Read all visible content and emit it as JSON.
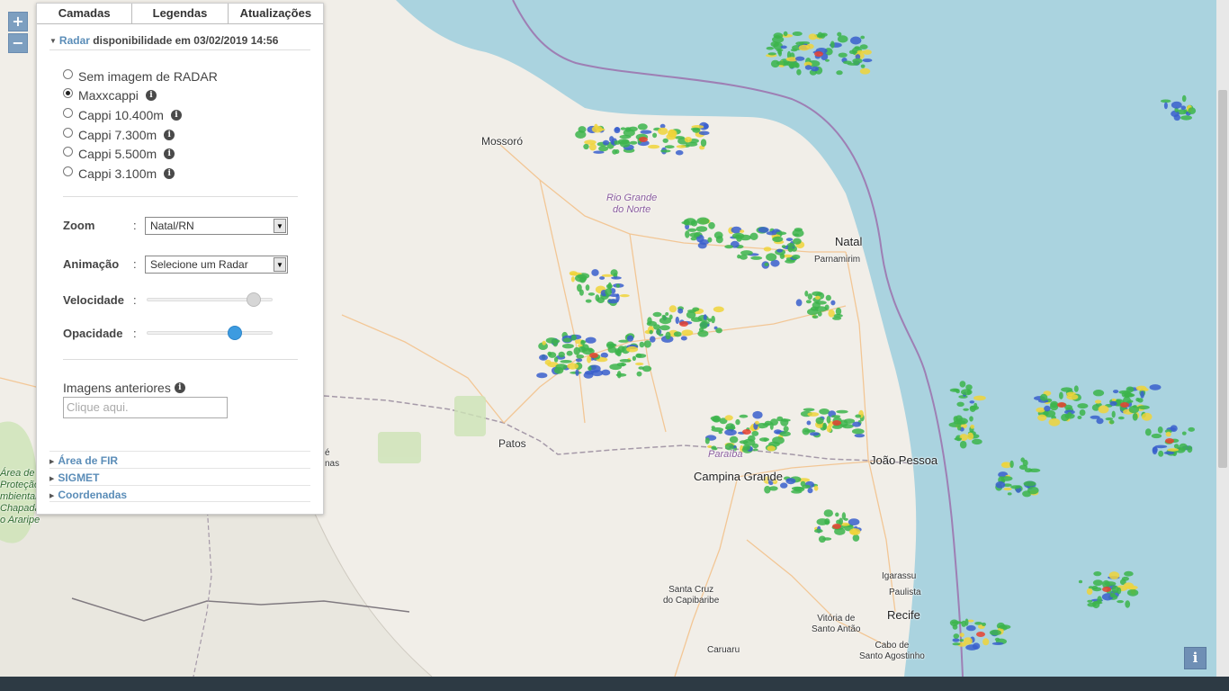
{
  "tabs": [
    "Camadas",
    "Legendas",
    "Atualizações"
  ],
  "radar": {
    "link_label": "Radar",
    "availability": "disponibilidade em 03/02/2019 14:56",
    "options": [
      {
        "label": "Sem imagem de RADAR",
        "selected": false,
        "info": false
      },
      {
        "label": "Maxxcappi",
        "selected": true,
        "info": true
      },
      {
        "label": "Cappi 10.400m",
        "selected": false,
        "info": true
      },
      {
        "label": "Cappi 7.300m",
        "selected": false,
        "info": true
      },
      {
        "label": "Cappi 5.500m",
        "selected": false,
        "info": true
      },
      {
        "label": "Cappi 3.100m",
        "selected": false,
        "info": true
      }
    ]
  },
  "controls": {
    "zoom_label": "Zoom",
    "zoom_value": "Natal/RN",
    "animation_label": "Animação",
    "animation_value": "Selecione um Radar",
    "speed_label": "Velocidade",
    "speed_level": 0.89,
    "opacity_label": "Opacidade",
    "opacity_level": 0.72,
    "colon": ":"
  },
  "previous": {
    "label": "Imagens anteriores",
    "placeholder": "Clique aqui."
  },
  "sections": [
    "Área de FIR",
    "SIGMET",
    "Coordenadas"
  ],
  "zoom_buttons": {
    "plus": "+",
    "minus": "−"
  },
  "info_button": "i",
  "map_labels": {
    "mossoro": "Mossoró",
    "rgn1": "Rio Grande",
    "rgn2": "do Norte",
    "natal": "Natal",
    "parnamirim": "Parnamirim",
    "patos": "Patos",
    "paraiba": "Paraíba",
    "campina": "Campina Grande",
    "joao": "João Pessoa",
    "igarassu": "Igarassu",
    "paulista": "Paulista",
    "recife": "Recife",
    "scc1": "Santa Cruz",
    "scc2": "do Capibaribe",
    "vitoria1": "Vitória de",
    "vitoria2": "Santo Antão",
    "caruaru": "Caruaru",
    "cabo1": "Cabo de",
    "cabo2": "Santo Agostinho",
    "apa1": "Área de",
    "apa2": "Proteção",
    "apa3": "mbiental",
    "apa4": "Chapada",
    "apa5": "o Araripe",
    "frag1": "é",
    "frag2": "nas"
  },
  "colors": {
    "ocean": "#aad3df",
    "land": "#f1eee8",
    "accent": "#5b8db8",
    "boundary": "#9e7fb4",
    "radar_green": "#3cb44b",
    "radar_yellow": "#f0d43a",
    "radar_red": "#e8412f",
    "radar_blue": "#3a5fcd"
  }
}
